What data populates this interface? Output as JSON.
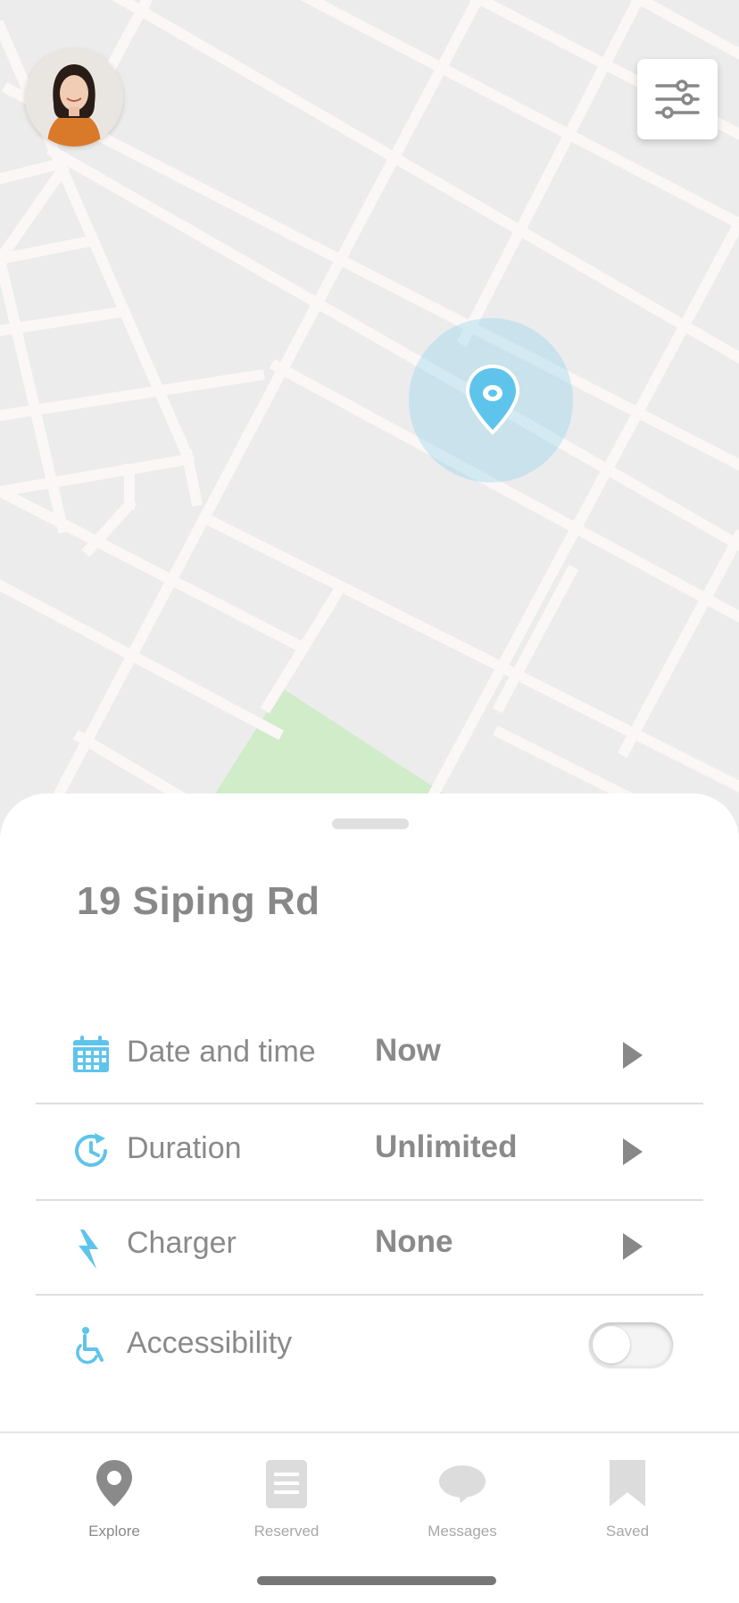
{
  "map": {
    "pin_color": "#5fc4ec",
    "park_color": "#d0ecc9",
    "road_color": "#fbf7f6",
    "background_color": "#ececec"
  },
  "header": {
    "avatar_icon": "user-avatar",
    "filter_icon": "sliders-icon"
  },
  "sheet": {
    "address": "19 Siping Rd",
    "rows": [
      {
        "icon": "calendar-icon",
        "label": "Date and time",
        "value": "Now"
      },
      {
        "icon": "clock-refresh-icon",
        "label": "Duration",
        "value": "Unlimited"
      },
      {
        "icon": "lightning-icon",
        "label": "Charger",
        "value": "None"
      },
      {
        "icon": "wheelchair-icon",
        "label": "Accessibility",
        "toggle_on": false
      }
    ],
    "accent_color": "#5fc4ec"
  },
  "tabbar": {
    "tabs": [
      {
        "label": "Explore",
        "icon": "map-pin-icon",
        "active": true
      },
      {
        "label": "Reserved",
        "icon": "document-icon",
        "active": false
      },
      {
        "label": "Messages",
        "icon": "chat-bubble-icon",
        "active": false
      },
      {
        "label": "Saved",
        "icon": "bookmark-icon",
        "active": false
      }
    ]
  }
}
